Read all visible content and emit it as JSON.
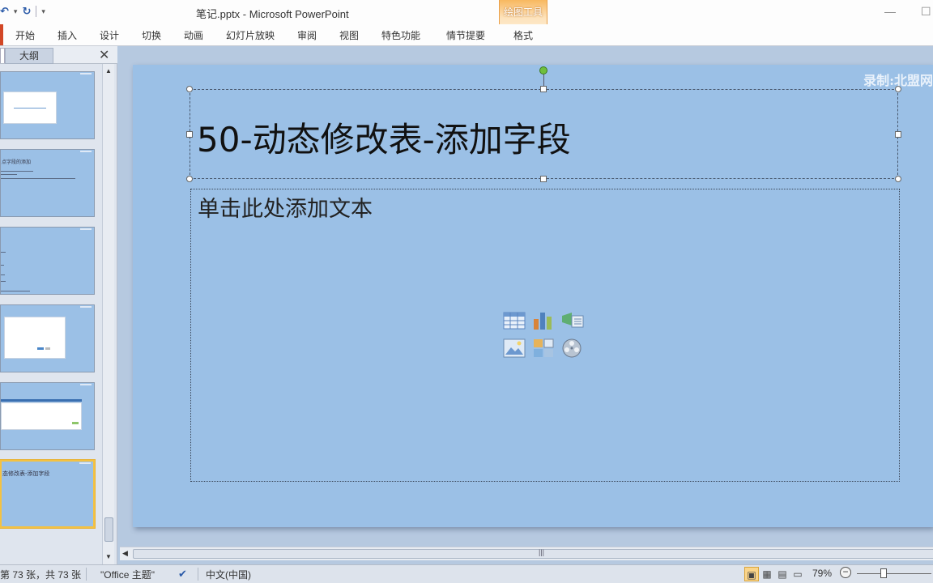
{
  "window": {
    "title": "笔记.pptx  -  Microsoft PowerPoint",
    "context_tab_group": "绘图工具",
    "minimize_icon": "minimize-icon",
    "maximize_icon": "maximize-icon"
  },
  "qat": {
    "undo_glyph": "↶",
    "undo_dropdown": "▾",
    "redo_glyph": "↻",
    "customize_glyph": "▾"
  },
  "ribbon": {
    "tabs": [
      {
        "label": "开始"
      },
      {
        "label": "插入"
      },
      {
        "label": "设计"
      },
      {
        "label": "切换"
      },
      {
        "label": "动画"
      },
      {
        "label": "幻灯片放映"
      },
      {
        "label": "审阅"
      },
      {
        "label": "视图"
      },
      {
        "label": "特色功能"
      },
      {
        "label": "情节提要"
      },
      {
        "label": "格式"
      }
    ]
  },
  "left_panel": {
    "outline_tab": "大纲",
    "close_glyph": "✕",
    "thumbnails": [
      {
        "title": "",
        "selected": false
      },
      {
        "title": "点字段的添加",
        "selected": false
      },
      {
        "title": "",
        "selected": false
      },
      {
        "title": "",
        "selected": false
      },
      {
        "title": "",
        "selected": false
      },
      {
        "title": "态修改表-添加字段",
        "selected": true
      }
    ],
    "scroll_up": "▲",
    "scroll_down": "▼"
  },
  "slide": {
    "watermark": "录制:北盟网",
    "title": "50-动态修改表-添加字段",
    "content_placeholder": "单击此处添加文本",
    "content_icons": [
      "insert-table-icon",
      "insert-chart-icon",
      "insert-smartart-icon",
      "insert-picture-icon",
      "insert-clipart-icon",
      "insert-media-icon"
    ]
  },
  "status_bar": {
    "slide_info": "第 73 张，共 73 张",
    "theme": "\"Office 主题\"",
    "language": "中文(中国)",
    "zoom": "79%",
    "zoom_level_percent": 79
  },
  "colors": {
    "slide_bg": "#9bc0e6",
    "editor_bg": "#b6c9e0",
    "context_tab": "#f8b860",
    "file_tab": "#d24726",
    "rotation_handle": "#6fbf3c"
  }
}
